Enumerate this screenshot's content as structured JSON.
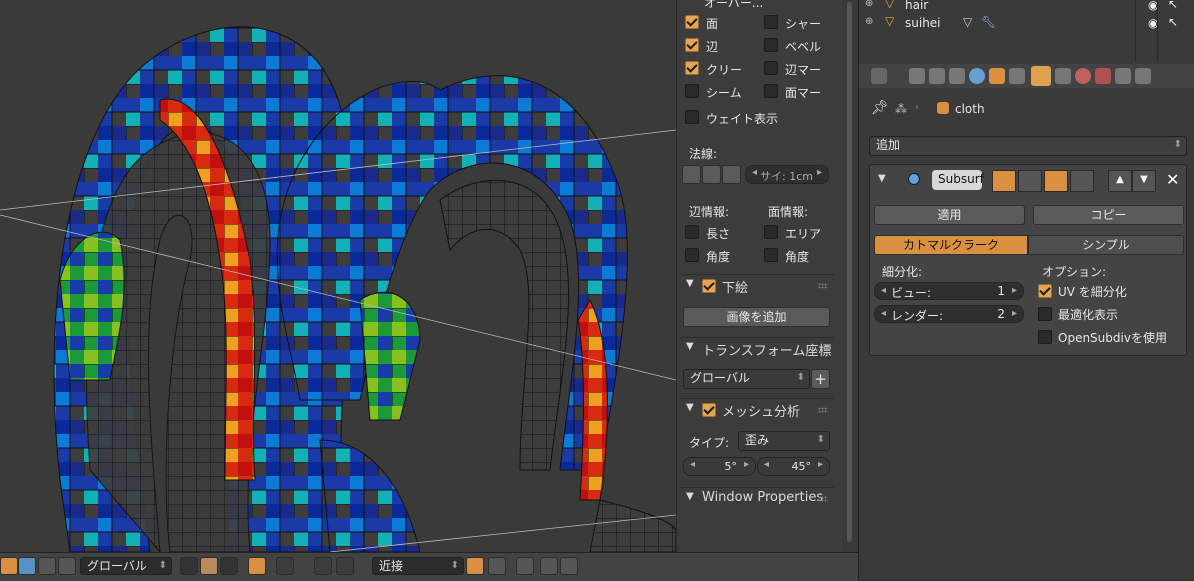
{
  "viewport": {
    "label": "3D Viewport mesh"
  },
  "npanel": {
    "overlay_header": "オーバー...",
    "overlays": [
      {
        "label": "面",
        "checked": true
      },
      {
        "label": "辺",
        "checked": true
      },
      {
        "label": "クリー",
        "checked": true
      },
      {
        "label": "シーム",
        "checked": false
      }
    ],
    "overlays_right": [
      {
        "label": "シャー",
        "checked": false
      },
      {
        "label": "ベベル",
        "checked": false
      },
      {
        "label": "辺マー",
        "checked": false
      },
      {
        "label": "面マー",
        "checked": false
      }
    ],
    "weight_label": "ウェイト表示",
    "normals_label": "法線:",
    "normal_size": "サイ: 1cm",
    "edge_info_label": "辺情報:",
    "face_info_label": "面情報:",
    "edge_length": "長さ",
    "edge_angle": "角度",
    "face_area": "エリア",
    "face_angle": "角度",
    "background_images": {
      "title": "下絵",
      "add_button": "画像を追加"
    },
    "transform_orientation": {
      "title": "トランスフォーム座標",
      "value": "グローバル",
      "add": "+"
    },
    "mesh_analysis": {
      "title": "メッシュ分析",
      "type_label": "タイプ:",
      "type_value": "歪み",
      "min": "5°",
      "max": "45°"
    },
    "window_properties": {
      "title": "Window Properties"
    }
  },
  "outliner": {
    "items": [
      {
        "name": "hair"
      },
      {
        "name": "suihei"
      }
    ]
  },
  "properties": {
    "object_name": "cloth",
    "add_modifier": "追加",
    "modifier": {
      "name": "Subsurf",
      "apply": "適用",
      "copy": "コピー",
      "catmull": "カトマルクラーク",
      "simple": "シンプル",
      "subdiv_label": "細分化:",
      "options_label": "オプション:",
      "view_label": "ビュー:",
      "view_value": "1",
      "render_label": "レンダー:",
      "render_value": "2",
      "uv_subdiv": "UV を細分化",
      "optimal": "最適化表示",
      "opensubdiv": "OpenSubdivを使用"
    }
  },
  "bottombar": {
    "orientation": "グローバル",
    "snap": "近接"
  }
}
